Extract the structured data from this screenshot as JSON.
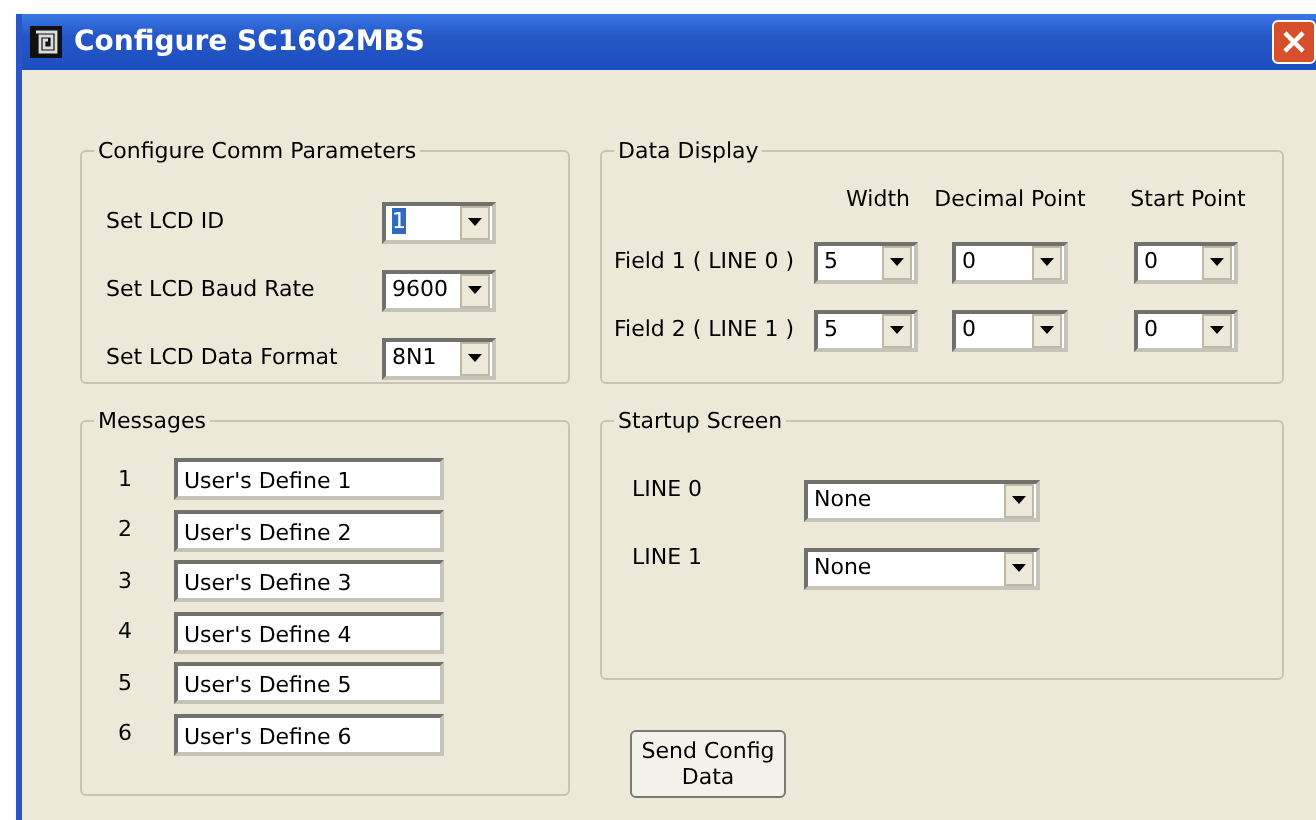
{
  "window": {
    "title": "Configure SC1602MBS"
  },
  "comm_parameters": {
    "title": "Configure Comm Parameters",
    "rows": [
      {
        "label": "Set LCD ID",
        "value": "1",
        "text_selected": true
      },
      {
        "label": "Set LCD Baud Rate",
        "value": "9600",
        "text_selected": false
      },
      {
        "label": "Set LCD Data Format",
        "value": "8N1",
        "text_selected": false
      }
    ]
  },
  "data_display": {
    "title": "Data Display",
    "columns": [
      "Width",
      "Decimal Point",
      "Start Point"
    ],
    "rows": [
      {
        "label": "Field 1 ( LINE 0 )",
        "values": [
          "5",
          "0",
          "0"
        ]
      },
      {
        "label": "Field 2 ( LINE 1 )",
        "values": [
          "5",
          "0",
          "0"
        ]
      }
    ]
  },
  "messages": {
    "title": "Messages",
    "rows": [
      {
        "number": "1",
        "value": "User's Define 1"
      },
      {
        "number": "2",
        "value": "User's Define 2"
      },
      {
        "number": "3",
        "value": "User's Define 3"
      },
      {
        "number": "4",
        "value": "User's Define 4"
      },
      {
        "number": "5",
        "value": "User's Define 5"
      },
      {
        "number": "6",
        "value": "User's Define 6"
      }
    ]
  },
  "startup_screen": {
    "title": "Startup Screen",
    "rows": [
      {
        "label": "LINE 0",
        "value": "None"
      },
      {
        "label": "LINE 1",
        "value": "None"
      }
    ]
  },
  "buttons": [
    "Send Config Data"
  ]
}
